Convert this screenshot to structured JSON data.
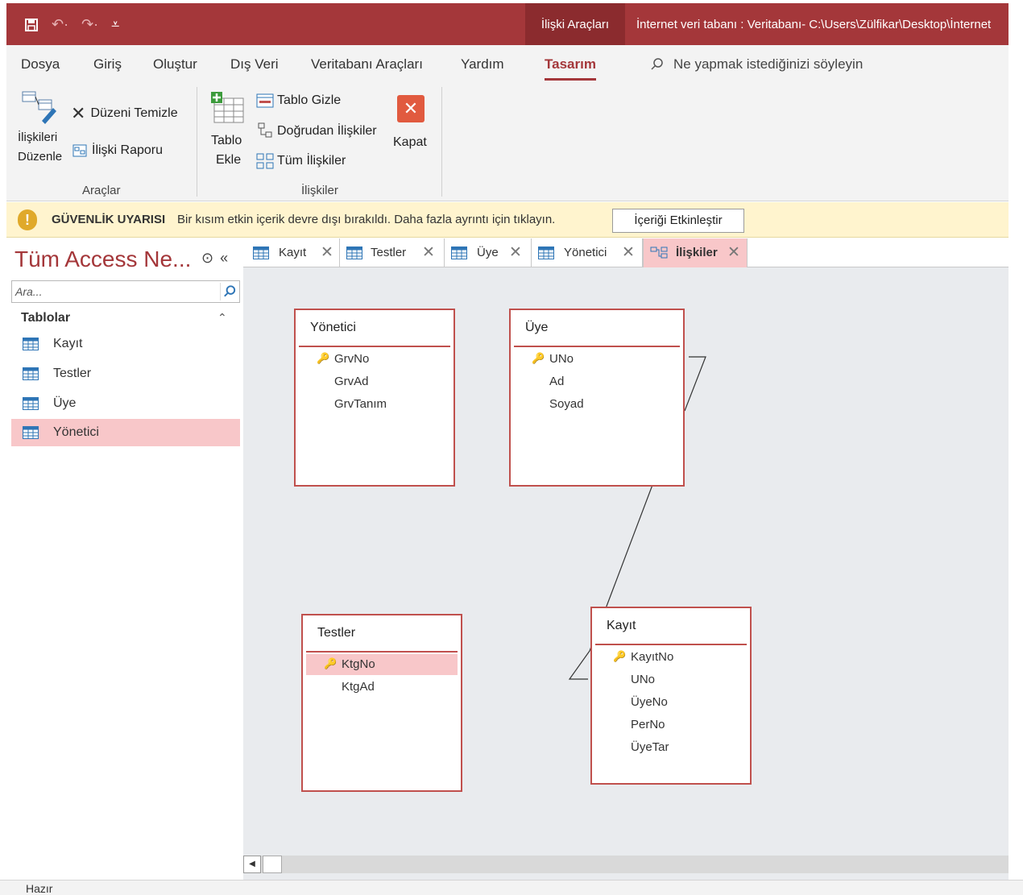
{
  "titlebar": {
    "context_tab": "İlişki Araçları",
    "document_title": "İnternet veri tabanı : Veritabanı- C:\\Users\\Zülfikar\\Desktop\\İnternet",
    "accent_color": "#a4373a"
  },
  "menu": {
    "items": [
      "Dosya",
      "Giriş",
      "Oluştur",
      "Dış Veri",
      "Veritabanı Araçları",
      "Yardım",
      "Tasarım"
    ],
    "active": "Tasarım",
    "tellme": "Ne yapmak istediğinizi söyleyin"
  },
  "ribbon": {
    "edit_relationships_1": "İlişkileri",
    "edit_relationships_2": "Düzenle",
    "clear_layout": "Düzeni Temizle",
    "relationship_report": "İlişki Raporu",
    "group_tools": "Araçlar",
    "add_table_1": "Tablo",
    "add_table_2": "Ekle",
    "hide_table": "Tablo Gizle",
    "direct_relationships": "Doğrudan İlişkiler",
    "all_relationships": "Tüm İlişkiler",
    "close": "Kapat",
    "group_relationships": "İlişkiler"
  },
  "security": {
    "title": "GÜVENLİK UYARISI",
    "message": "Bir kısım etkin içerik devre dışı bırakıldı. Daha fazla ayrıntı için tıklayın.",
    "button": "İçeriği Etkinleştir"
  },
  "nav": {
    "title": "Tüm Access Ne...",
    "search_placeholder": "Ara...",
    "group": "Tablolar",
    "items": [
      "Kayıt",
      "Testler",
      "Üye",
      "Yönetici"
    ],
    "selected": "Yönetici"
  },
  "tabs": [
    {
      "label": "Kayıt"
    },
    {
      "label": "Testler"
    },
    {
      "label": "Üye"
    },
    {
      "label": "Yönetici"
    },
    {
      "label": "İlişkiler",
      "active": true
    }
  ],
  "tables": {
    "yonetici": {
      "name": "Yönetici",
      "fields": [
        "GrvNo",
        "GrvAd",
        "GrvTanım"
      ]
    },
    "uye": {
      "name": "Üye",
      "fields": [
        "UNo",
        "Ad",
        "Soyad"
      ]
    },
    "testler": {
      "name": "Testler",
      "fields": [
        "KtgNo",
        "KtgAd"
      ]
    },
    "kayit": {
      "name": "Kayıt",
      "fields": [
        "KayıtNo",
        "UNo",
        "ÜyeNo",
        "PerNo",
        "ÜyeTar"
      ]
    }
  },
  "status": {
    "text": "Hazır"
  }
}
